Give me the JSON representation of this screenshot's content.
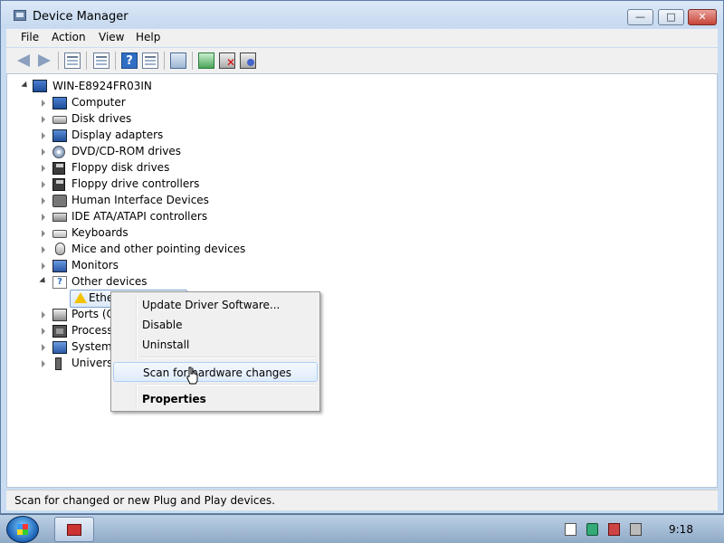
{
  "window": {
    "title": "Device Manager",
    "buttons": {
      "minimize": "—",
      "maximize": "□",
      "close": "✕"
    }
  },
  "menubar": {
    "items": [
      {
        "label": "File",
        "accel": "F"
      },
      {
        "label": "Action",
        "accel": "A"
      },
      {
        "label": "View",
        "accel": "V"
      },
      {
        "label": "Help",
        "accel": "H"
      }
    ]
  },
  "toolbar": {
    "icons": [
      "back-icon",
      "forward-icon",
      "show-hide-console-tree-icon",
      "properties-sheet-icon",
      "help-icon",
      "action-pane-icon",
      "scan-hardware-icon",
      "update-driver-icon",
      "uninstall-icon",
      "disable-icon"
    ]
  },
  "tree": {
    "root": "WIN-E8924FR03IN",
    "categories": [
      {
        "label": "Computer",
        "icon": "computer-icon"
      },
      {
        "label": "Disk drives",
        "icon": "disk-drive-icon"
      },
      {
        "label": "Display adapters",
        "icon": "display-adapter-icon"
      },
      {
        "label": "DVD/CD-ROM drives",
        "icon": "dvd-drive-icon"
      },
      {
        "label": "Floppy disk drives",
        "icon": "floppy-disk-icon"
      },
      {
        "label": "Floppy drive controllers",
        "icon": "floppy-controller-icon"
      },
      {
        "label": "Human Interface Devices",
        "icon": "hid-icon"
      },
      {
        "label": "IDE ATA/ATAPI controllers",
        "icon": "ide-controller-icon"
      },
      {
        "label": "Keyboards",
        "icon": "keyboard-icon"
      },
      {
        "label": "Mice and other pointing devices",
        "icon": "mouse-icon"
      },
      {
        "label": "Monitors",
        "icon": "monitor-icon"
      },
      {
        "label": "Other devices",
        "icon": "other-devices-icon",
        "expanded": true
      },
      {
        "label": "Ether",
        "icon": "warning-device-icon",
        "child": true,
        "selected": true
      },
      {
        "label": "Ports (CO",
        "icon": "port-icon"
      },
      {
        "label": "Processo",
        "icon": "processor-icon"
      },
      {
        "label": "System d",
        "icon": "system-device-icon"
      },
      {
        "label": "Universa",
        "icon": "usb-icon"
      }
    ]
  },
  "context_menu": {
    "items": [
      {
        "label": "Update Driver Software...",
        "accel": "U"
      },
      {
        "label": "Disable",
        "accel": "D"
      },
      {
        "label": "Uninstall",
        "accel": "U"
      },
      {
        "label": "Scan for hardware changes",
        "accel": "A",
        "highlighted": true
      },
      {
        "label": "Properties",
        "accel": "R",
        "bold": true
      }
    ]
  },
  "statusbar": {
    "text": "Scan for changed or new Plug and Play devices."
  },
  "taskbar": {
    "clock": "9:18"
  }
}
